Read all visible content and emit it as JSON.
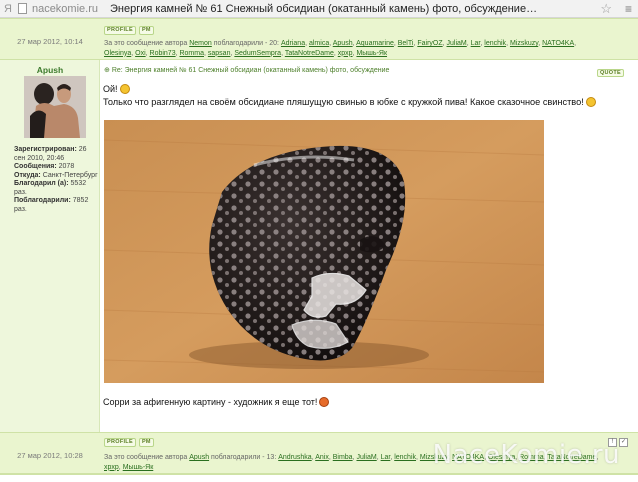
{
  "browser": {
    "menu_letter": "Я",
    "domain": "nacekomie.ru",
    "title": "Энергия камней № 61 Снежный обсидиан (окатанный камень) фото, обсуждение - Страниц..."
  },
  "top_meta": {
    "date": "27 мар 2012, 10:14",
    "profile_label": "PROFILE",
    "pm_label": "PM",
    "thanks_prefix": "За это сообщение автора",
    "thanks_author": "Nemon",
    "thanks_middle": "поблагодарили - 20:",
    "thanks_users": [
      "Adriana",
      "almica",
      "Apush",
      "Aquamarine",
      "BelTi",
      "FairyOZ",
      "JuliaM",
      "Lar",
      "lenchik",
      "Mizskuzy",
      "NATO4KA",
      "Olesinya",
      "Oxi",
      "Robin73",
      "Romma",
      "sapsan",
      "SedumSempra",
      "TataNotreDame",
      "xpxp",
      "Мышь-Як"
    ]
  },
  "post": {
    "author": "Apush",
    "info": [
      {
        "label": "Зарегистрирован:",
        "value": "26 сен 2010, 20:46"
      },
      {
        "label": "Сообщения:",
        "value": "2078"
      },
      {
        "label": "Откуда:",
        "value": "Санкт-Петербург"
      },
      {
        "label": "Благодарил (а):",
        "value": "5532 раз."
      },
      {
        "label": "Поблагодарили:",
        "value": "7852 раз."
      }
    ],
    "subject": "Re: Энергия камней № 61 Снежный обсидиан (окатанный камень) фото, обсуждение",
    "quote_label": "QUOTE",
    "greeting": "Ой!",
    "text1": "Только что разглядел на своём обсидиане пляшущую свинью в юбке с кружкой пива! Какое сказочное свинство!",
    "text2": "Сорри за афигенную картину - художник я еще тот!"
  },
  "bottom_meta": {
    "date": "27 мар 2012, 10:28",
    "profile_label": "PROFILE",
    "pm_label": "PM",
    "thanks_prefix": "За это сообщение автора",
    "thanks_author": "Apush",
    "thanks_middle": "поблагодарили - 13:",
    "thanks_users": [
      "Andrushka",
      "Anix",
      "Bimba",
      "JuliaM",
      "Lar",
      "lenchik",
      "Mizskuzy",
      "NATO4KA",
      "Olesinya",
      "Romma",
      "TataNotreDame",
      "xpxp",
      "Мышь-Як"
    ]
  },
  "watermark": "NaceKomie.ru",
  "colors": {
    "accent": "#3c7a2c",
    "meta_bg": "#eaf5cf",
    "side_bg": "#eef7dc"
  }
}
